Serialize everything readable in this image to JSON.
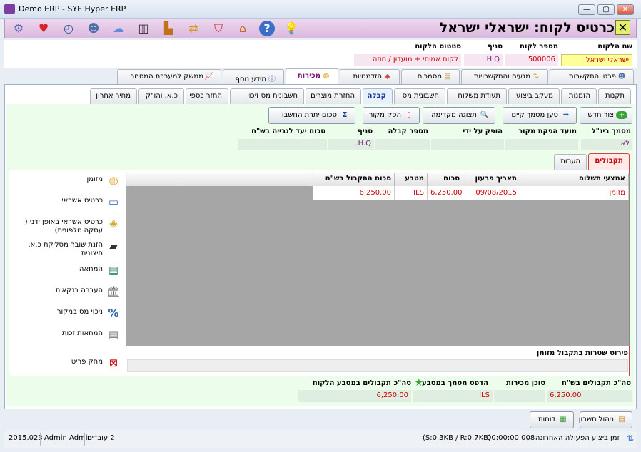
{
  "window": {
    "title": "Demo ERP - SYE Hyper ERP"
  },
  "page": {
    "title": "כרטיס לקוח: ישראלי ישראל"
  },
  "toolbar_icons": [
    "settings-icon",
    "favorite-heart-icon",
    "clock-icon",
    "users-icon",
    "cloud-icon",
    "barcode-icon",
    "factory-icon",
    "exchange-icon",
    "basket-icon",
    "home-icon",
    "help-icon",
    "bulb-icon"
  ],
  "customer": {
    "name_label": "שם הלקוח",
    "number_label": "מספר לקוח",
    "branch_label": "סניף",
    "status_label": "סטטוס הלקוח",
    "name_value": "ישראלי ישראל",
    "number_value": "500006",
    "branch_value": "H.Q.",
    "status_value": "לקוח אמיתי + מועדון / חוזה"
  },
  "main_tabs": [
    "פרטי התקשרות",
    "מגעים והתקשרויות",
    "מסמכים",
    "הזדמנויות",
    "מכירות",
    "מידע נוסף",
    "ממשק למערכת המסחר"
  ],
  "sub_tabs": [
    "תקנות",
    "הזמנות",
    "מעקב ביצוע",
    "תעודת משלוח",
    "חשבונית מס",
    "קבלה",
    "החזרת מוצרים",
    "חשבונית מס זיכוי",
    "החזר כספי",
    "כ.א. והו\"ק",
    "מחיר אחרון"
  ],
  "buttons": {
    "new": "צור חדש",
    "load": "טען מסמך קיים",
    "preview": "תצוגה מקדימה",
    "produce": "הפק מקור",
    "balance": "סכום יתרת החשבון"
  },
  "fields": {
    "doc_label": "מסמך בינ\"ל",
    "date_label": "מועד הפקת מקור",
    "producer_label": "הופק על ידי",
    "receipt_label": "מספר קבלה",
    "branch_label": "סניף",
    "target_label": "סכום יעד לגבייה בש\"ח",
    "doc_value": "לא",
    "branch_value": "H.Q."
  },
  "inner_tabs": [
    "תקבולים",
    "הערות"
  ],
  "grid": {
    "headers": [
      "אמצעי תשלום",
      "תאריך פרעון",
      "סכום",
      "מטבע",
      "סכום התקבול בש\"ח"
    ],
    "rows": [
      [
        "מזומן",
        "09/08/2015",
        "6,250.00",
        "ILS",
        "6,250.00"
      ]
    ]
  },
  "payment_methods": [
    "מזומן",
    "כרטיס אשראי",
    "כרטיס אשראי באופן ידני ( עסקה טלפונית)",
    "הזנת שובר מסליקת כ.א. חיצונית",
    "המחאה",
    "העברה בנקאית",
    "ניכוי מס במקור",
    "המחאות זכות"
  ],
  "delete_row": "מחק פריט",
  "cash_details": "פירוט שטרות בתקבול מזומן",
  "totals": {
    "total_label": "סה\"כ תקבולים בש\"ח",
    "agent_label": "סוכן מכירות",
    "print_label": "הדפס מסמך במטבע",
    "currency_total_label": "סה\"כ תקבולים במטבע הלקוח",
    "total_value": "6,250.00",
    "print_value": "ILS",
    "currency_total_value": "6,250.00"
  },
  "bottom_buttons": {
    "accounts": "ניהול חשבון",
    "reports": "דוחות"
  },
  "status": {
    "last_action": "זמן ביצוע הפעולה האחרונה",
    "time": "00:00:00.008",
    "traffic": "(S:0.3KB / R:0.7KB)",
    "employees": "2 עובדים",
    "user": "Admin Admin",
    "version": "2015.023"
  }
}
